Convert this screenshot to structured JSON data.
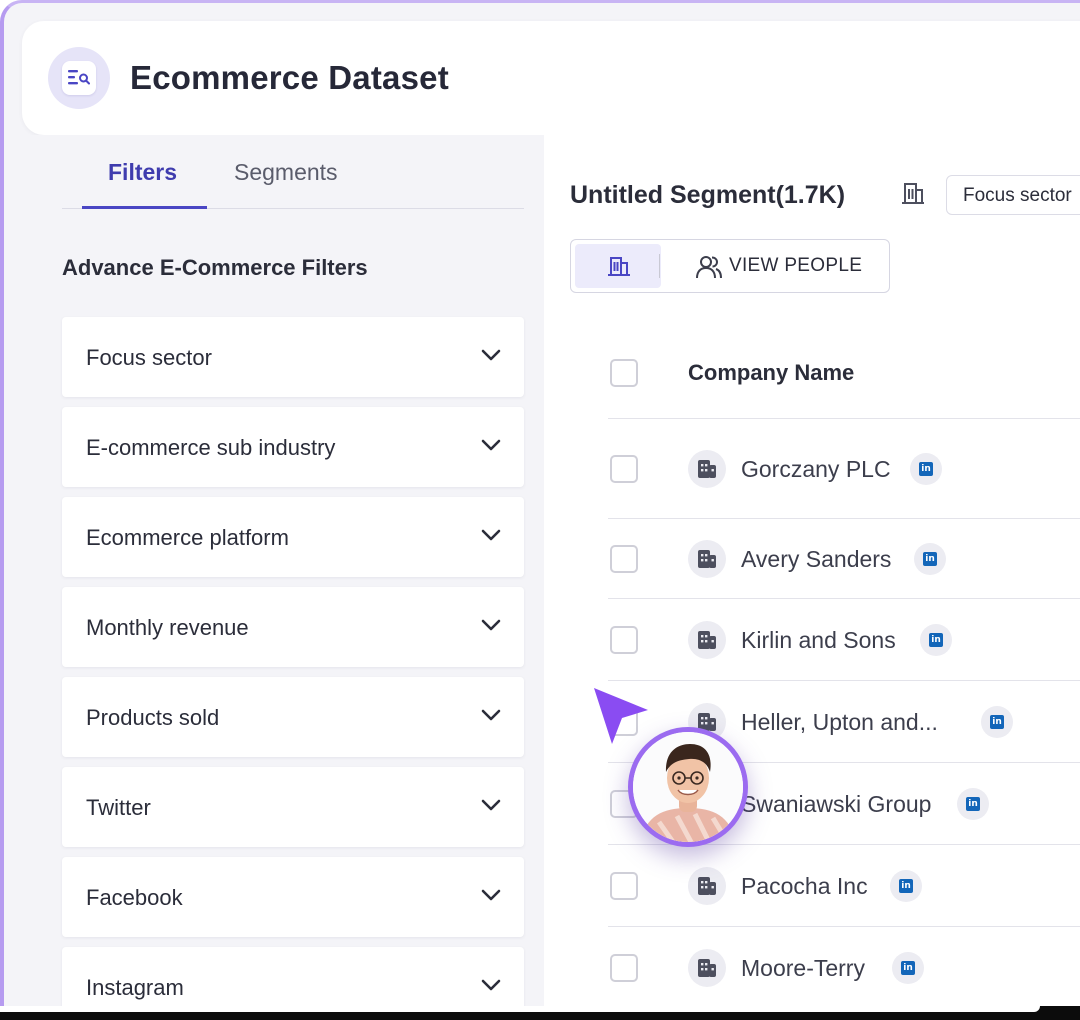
{
  "header": {
    "title": "Ecommerce Dataset",
    "icon": "dataset-search-icon"
  },
  "tabs": [
    {
      "label": "Filters",
      "active": true
    },
    {
      "label": "Segments",
      "active": false
    }
  ],
  "filters": {
    "heading": "Advance E-Commerce Filters",
    "items": [
      {
        "label": "Focus sector"
      },
      {
        "label": "E-commerce sub industry"
      },
      {
        "label": "Ecommerce platform"
      },
      {
        "label": "Monthly revenue"
      },
      {
        "label": "Products sold"
      },
      {
        "label": "Twitter"
      },
      {
        "label": "Facebook"
      },
      {
        "label": "Instagram"
      }
    ]
  },
  "segment": {
    "title": "Untitled Segment(1.7K)",
    "chip": "Focus sector",
    "view_people": "VIEW PEOPLE"
  },
  "table": {
    "column": "Company Name",
    "rows": [
      {
        "name": "Gorczany PLC"
      },
      {
        "name": "Avery Sanders"
      },
      {
        "name": "Kirlin and Sons"
      },
      {
        "name": "Heller, Upton and..."
      },
      {
        "name": "Swaniawski Group"
      },
      {
        "name": "Pacocha Inc"
      },
      {
        "name": "Moore-Terry"
      }
    ]
  },
  "colors": {
    "accent": "#3f3cae",
    "cursor": "#8a4cf2",
    "linkedin": "#1366b9"
  }
}
